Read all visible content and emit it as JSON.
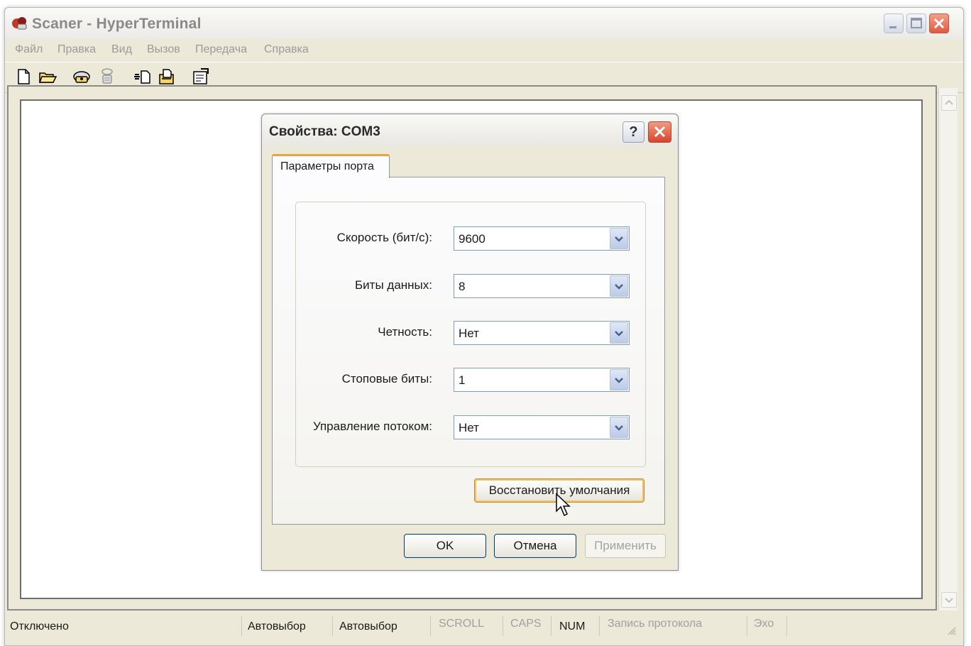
{
  "window": {
    "title": "Scaner - HyperTerminal",
    "menu": [
      "Файл",
      "Правка",
      "Вид",
      "Вызов",
      "Передача",
      "Справка"
    ],
    "toolbar_icons": [
      "new-file-icon",
      "open-folder-icon",
      "call-phone-icon",
      "disconnect-icon",
      "send-file-icon",
      "receive-file-icon",
      "properties-icon"
    ]
  },
  "status": {
    "connection": "Отключено",
    "detect1": "Автовыбор",
    "detect2": "Автовыбор",
    "scroll": "SCROLL",
    "caps": "CAPS",
    "num": "NUM",
    "capture": "Запись протокола",
    "echo": "Эхо"
  },
  "dialog": {
    "title": "Свойства: COM3",
    "tab": "Параметры порта",
    "fields": [
      {
        "label": "Скорость (бит/с):",
        "value": "9600"
      },
      {
        "label": "Биты данных:",
        "value": "8"
      },
      {
        "label": "Четность:",
        "value": "Нет"
      },
      {
        "label": "Стоповые биты:",
        "value": "1"
      },
      {
        "label": "Управление потоком:",
        "value": "Нет"
      }
    ],
    "restore_defaults": "Восстановить умолчания",
    "ok": "OK",
    "cancel": "Отмена",
    "apply": "Применить"
  }
}
